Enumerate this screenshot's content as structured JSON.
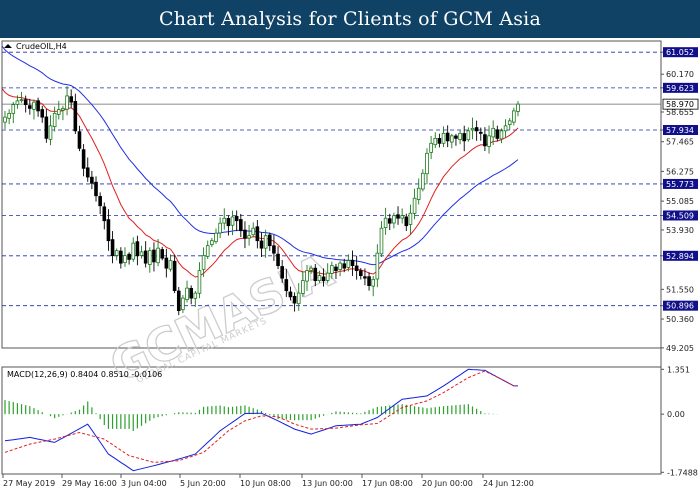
{
  "header": {
    "title": "Chart Analysis for Clients of GCM Asia"
  },
  "watermark": {
    "brand": "GCMASIA",
    "tagline": "GLOBAL CAPITAL MARKETS"
  },
  "colors": {
    "header_bg": "#0f4264",
    "bull": "#1a7a1a",
    "bear": "#000000",
    "ma_fast": "#e02020",
    "ma_slow": "#2030e0",
    "level_line": "#1f2fa8",
    "label_bg": "#10108a",
    "macd_line": "#1020e0",
    "signal_line": "#e02020",
    "histogram": "#2ca02c"
  },
  "chart_data": [
    {
      "type": "candlestick",
      "symbol": "CrudeOIL,H4",
      "ylim": [
        49.2,
        61.5
      ],
      "y_ticks": [
        61.052,
        60.17,
        59.623,
        58.655,
        57.934,
        57.465,
        56.275,
        55.773,
        55.085,
        54.509,
        53.93,
        52.894,
        51.55,
        50.896,
        50.36,
        49.205
      ],
      "y_tick_labels": [
        "61.052",
        "60.170",
        "59.623",
        "58.655",
        "57.934",
        "57.465",
        "56.275",
        "55.773",
        "55.085",
        "54.509",
        "53.930",
        "52.894",
        "51.550",
        "50.896",
        "50.360",
        "49.205"
      ],
      "levels": [
        61.052,
        59.623,
        58.97,
        57.934,
        55.773,
        54.509,
        52.894,
        50.896
      ],
      "level_labels": [
        "61.052",
        "59.623",
        "58.970",
        "57.934",
        "55.773",
        "54.509",
        "52.894",
        "50.896"
      ],
      "last_price": 58.97,
      "closes": [
        58.45,
        58.6,
        58.95,
        59.1,
        59.15,
        58.95,
        58.8,
        59.05,
        58.7,
        58.45,
        57.6,
        58.1,
        58.6,
        58.75,
        58.8,
        59.3,
        59.05,
        57.9,
        57.2,
        56.4,
        56.05,
        55.8,
        55.3,
        54.9,
        54.3,
        53.5,
        52.9,
        53.1,
        52.6,
        52.9,
        52.75,
        53.4,
        52.9,
        53.05,
        52.6,
        53.1,
        52.65,
        53.2,
        52.8,
        52.4,
        52.7,
        51.5,
        50.7,
        51.2,
        51.6,
        51.2,
        51.4,
        52.3,
        52.9,
        53.3,
        53.5,
        53.8,
        54.2,
        54.4,
        54.1,
        54.45,
        54.3,
        53.9,
        53.6,
        53.7,
        54.0,
        53.5,
        53.2,
        53.7,
        53.3,
        53.0,
        52.5,
        52.0,
        51.5,
        51.25,
        51.0,
        51.4,
        51.9,
        52.3,
        52.4,
        51.9,
        52.1,
        51.9,
        52.2,
        52.5,
        52.3,
        52.6,
        52.4,
        52.7,
        52.5,
        52.3,
        52.1,
        52.0,
        51.7,
        51.95,
        53.0,
        54.0,
        54.4,
        54.2,
        54.5,
        54.4,
        54.5,
        54.1,
        54.6,
        55.2,
        55.6,
        56.2,
        57.0,
        57.4,
        57.6,
        57.4,
        57.8,
        57.5,
        57.7,
        57.6,
        57.8,
        57.5,
        57.9,
        58.0,
        57.9,
        57.8,
        57.3,
        57.7,
        58.0,
        57.6,
        57.9,
        58.1,
        58.3,
        58.7,
        58.97
      ],
      "ma_fast_start": 59.6,
      "ma_slow_start": 61.3,
      "x_tick_labels": [
        "27 May 2019",
        "29 May 16:00",
        "3 Jun 04:00",
        "5 Jun 20:00",
        "10 Jun 08:00",
        "13 Jun 00:00",
        "17 Jun 08:00",
        "20 Jun 00:00",
        "24 Jun 12:00"
      ]
    },
    {
      "type": "line",
      "indicator_label": "MACD(12,26,9) 0.8404 0.8510 -0.0106",
      "ylim": [
        -1.8,
        1.42
      ],
      "y_ticks": [
        1.351,
        0.0,
        -1.7488
      ],
      "y_tick_labels": [
        "1.351",
        "0.00",
        "-1.7488"
      ],
      "macd_line_knots": [
        [
          0,
          -0.8
        ],
        [
          6,
          -0.7
        ],
        [
          12,
          -0.85
        ],
        [
          20,
          -0.3
        ],
        [
          25,
          -1.2
        ],
        [
          31,
          -1.7
        ],
        [
          36,
          -1.55
        ],
        [
          42,
          -1.35
        ],
        [
          46,
          -1.2
        ],
        [
          52,
          -0.5
        ],
        [
          58,
          0.02
        ],
        [
          62,
          0.03
        ],
        [
          66,
          -0.2
        ],
        [
          70,
          -0.45
        ],
        [
          74,
          -0.6
        ],
        [
          80,
          -0.35
        ],
        [
          86,
          -0.3
        ],
        [
          90,
          -0.1
        ],
        [
          96,
          0.45
        ],
        [
          102,
          0.55
        ],
        [
          106,
          0.85
        ],
        [
          112,
          1.35
        ],
        [
          116,
          1.32
        ],
        [
          120,
          1.05
        ],
        [
          123,
          0.85
        ]
      ],
      "signal_line_knots": [
        [
          0,
          -1.15
        ],
        [
          6,
          -0.9
        ],
        [
          12,
          -0.75
        ],
        [
          18,
          -0.55
        ],
        [
          24,
          -0.75
        ],
        [
          30,
          -1.25
        ],
        [
          36,
          -1.45
        ],
        [
          42,
          -1.4
        ],
        [
          48,
          -1.15
        ],
        [
          54,
          -0.5
        ],
        [
          58,
          -0.2
        ],
        [
          62,
          -0.05
        ],
        [
          66,
          -0.08
        ],
        [
          70,
          -0.3
        ],
        [
          74,
          -0.45
        ],
        [
          80,
          -0.42
        ],
        [
          86,
          -0.32
        ],
        [
          90,
          -0.28
        ],
        [
          96,
          0.2
        ],
        [
          102,
          0.4
        ],
        [
          106,
          0.65
        ],
        [
          112,
          1.1
        ],
        [
          116,
          1.3
        ],
        [
          120,
          1.05
        ],
        [
          123,
          0.85
        ]
      ],
      "histogram_amplitude": 0.55
    }
  ]
}
